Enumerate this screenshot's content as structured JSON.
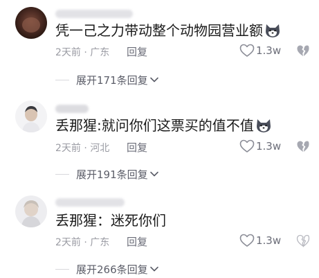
{
  "comments": [
    {
      "text": "凭一己之力带动整个动物园营业额",
      "has_emoji": true,
      "emoji": "husky-emoji",
      "time": "2天前",
      "location": "广东",
      "reply_label": "回复",
      "likes": "1.3w",
      "expand_label": "展开171条回复"
    },
    {
      "text": "丢那猩:就问你们这票买的值不值",
      "has_emoji": true,
      "emoji": "husky-emoji",
      "time": "2天前",
      "location": "河北",
      "reply_label": "回复",
      "likes": "1.3w",
      "expand_label": "展开191条回复"
    },
    {
      "text": "丢那猩：迷死你们",
      "has_emoji": false,
      "time": "2天前",
      "location": "广东",
      "reply_label": "回复",
      "likes": "1.3w",
      "expand_label": "展开266条回复"
    }
  ],
  "meta_separator": " · ",
  "colors": {
    "text": "#1a1a1a",
    "meta": "#9a9ba3",
    "action": "#6b6d78"
  },
  "icons": {
    "like": "heart-outline-icon",
    "dislike": "broken-heart-icon",
    "expand": "chevron-down-icon"
  }
}
